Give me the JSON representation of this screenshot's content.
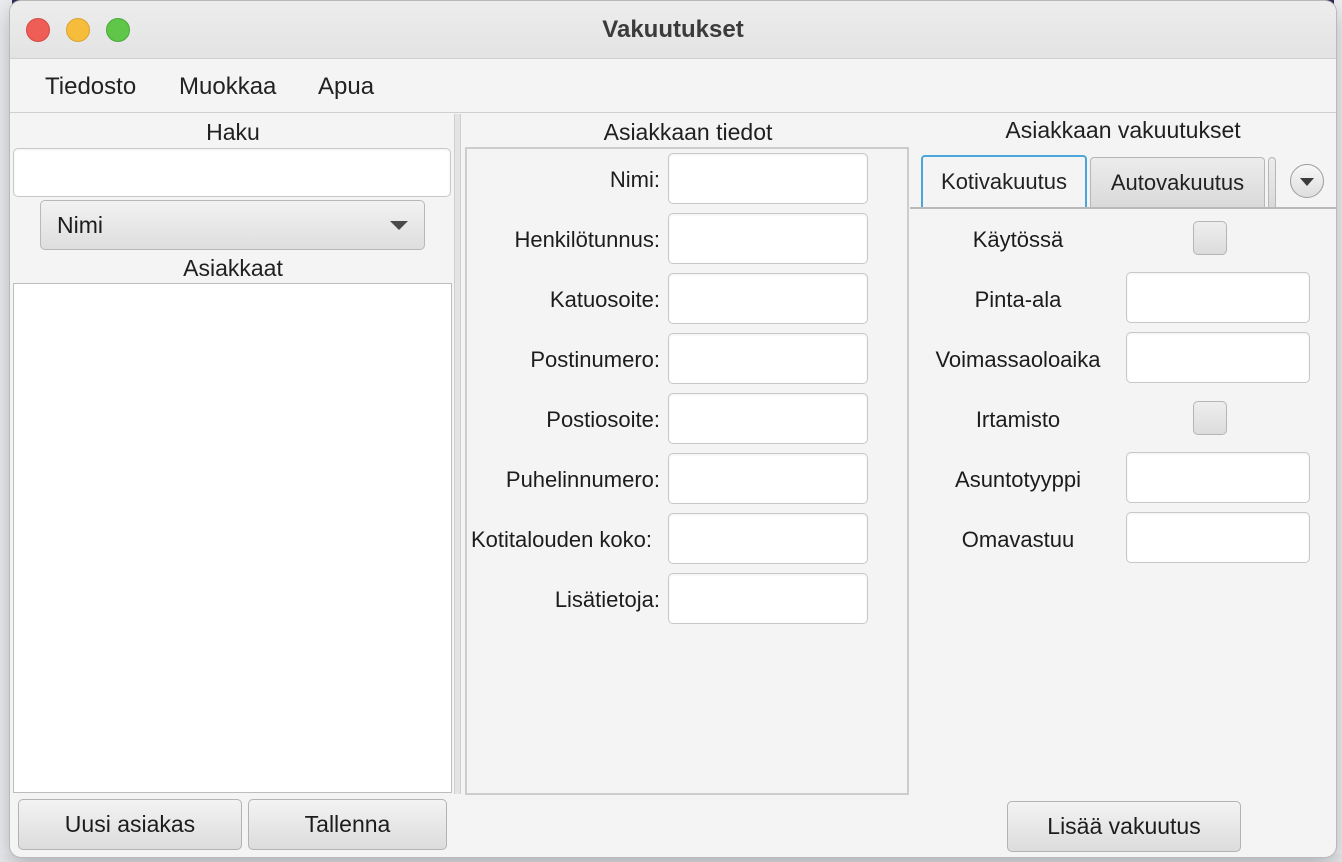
{
  "window": {
    "title": "Vakuutukset"
  },
  "menu": {
    "items": [
      "Tiedosto",
      "Muokkaa",
      "Apua"
    ]
  },
  "search": {
    "header": "Haku",
    "query": "",
    "field_selector": "Nimi",
    "customers_header": "Asiakkaat"
  },
  "customer_details": {
    "header": "Asiakkaan tiedot",
    "fields": [
      {
        "label": "Nimi:",
        "value": ""
      },
      {
        "label": "Henkilötunnus:",
        "value": ""
      },
      {
        "label": "Katuosoite:",
        "value": ""
      },
      {
        "label": "Postinumero:",
        "value": ""
      },
      {
        "label": "Postiosoite:",
        "value": ""
      },
      {
        "label": "Puhelinnumero:",
        "value": ""
      },
      {
        "label": "Kotitalouden koko:",
        "value": ""
      },
      {
        "label": "Lisätietoja:",
        "value": ""
      }
    ]
  },
  "insurances": {
    "header": "Asiakkaan vakuutukset",
    "tabs": [
      "Kotivakuutus",
      "Autovakuutus"
    ],
    "active_tab": "Kotivakuutus",
    "fields": {
      "in_use": {
        "label": "Käytössä",
        "checked": false
      },
      "area": {
        "label": "Pinta-ala",
        "value": ""
      },
      "validity": {
        "label": "Voimassaoloaika",
        "value": ""
      },
      "movables": {
        "label": "Irtamisto",
        "checked": false
      },
      "housing_type": {
        "label": "Asuntotyyppi",
        "value": ""
      },
      "deductible": {
        "label": "Omavastuu",
        "value": ""
      }
    }
  },
  "buttons": {
    "new_customer": "Uusi asiakas",
    "save": "Tallenna",
    "add_insurance": "Lisää vakuutus"
  }
}
